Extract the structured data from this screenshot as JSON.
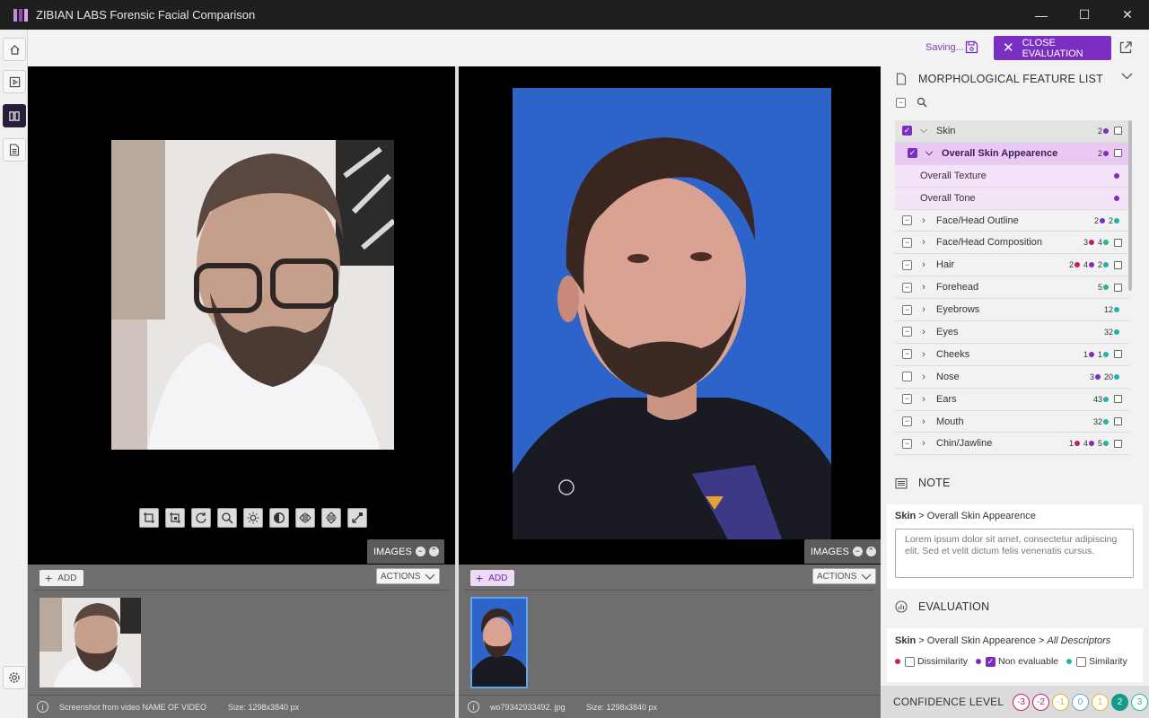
{
  "window": {
    "title": "ZIBIAN LABS Forensic Facial Comparison",
    "minimize": "—",
    "maximize": "☐",
    "close": "✕"
  },
  "rail": {
    "items": [
      "home-icon",
      "video-icon",
      "compare-icon",
      "document-icon"
    ],
    "settings": "gear-icon"
  },
  "toolbar": {
    "saving_label": "Saving...",
    "close_evaluation_label": "CLOSE EVALUATION",
    "close_x": "✕"
  },
  "left_pane": {
    "images_tab": "IMAGES",
    "add_label": "ADD",
    "actions_label": "ACTIONS",
    "info_text": "Screenshot from video NAME OF VIDEO",
    "size_text": "Size: 1298x3840 px",
    "tools": [
      "crop-icon",
      "crop-alt-icon",
      "rotate-icon",
      "zoom-icon",
      "brightness-icon",
      "contrast-icon",
      "flip-horizontal-icon",
      "flip-vertical-icon",
      "expand-icon"
    ]
  },
  "right_pane": {
    "images_tab": "IMAGES",
    "add_label": "ADD",
    "actions_label": "ACTIONS",
    "info_text": "wo79342933492. jpg",
    "size_text": "Size: 1298x3840 px"
  },
  "features": {
    "title": "MORPHOLOGICAL FEATURE LIST",
    "items": [
      {
        "label": "Skin",
        "chev": "⌵",
        "counts": [
          {
            "n": "2",
            "c": "p"
          }
        ],
        "cal": true,
        "state": "checked",
        "style": "sel0"
      },
      {
        "label": "Overall Skin Appearence",
        "chev": "⌵",
        "counts": [
          {
            "n": "2",
            "c": "p"
          }
        ],
        "cal": true,
        "state": "checked",
        "style": "sel1"
      },
      {
        "label": "Overall Texture",
        "chev": "",
        "counts": [
          {
            "n": "",
            "c": "p"
          }
        ],
        "cal": false,
        "state": "none",
        "style": "sub"
      },
      {
        "label": "Overall Tone",
        "chev": "",
        "counts": [
          {
            "n": "",
            "c": "p"
          }
        ],
        "cal": false,
        "state": "none",
        "style": "sub"
      },
      {
        "label": "Face/Head Outline",
        "chev": "›",
        "counts": [
          {
            "n": "2",
            "c": "p"
          },
          {
            "n": "2",
            "c": "t"
          }
        ],
        "cal": false,
        "state": "partial",
        "style": ""
      },
      {
        "label": "Face/Head Composition",
        "chev": "›",
        "counts": [
          {
            "n": "3",
            "c": "r"
          },
          {
            "n": "4",
            "c": "t"
          }
        ],
        "cal": true,
        "state": "partial",
        "style": ""
      },
      {
        "label": "Hair",
        "chev": "›",
        "counts": [
          {
            "n": "2",
            "c": "r"
          },
          {
            "n": "4",
            "c": "p"
          },
          {
            "n": "2",
            "c": "t"
          }
        ],
        "cal": true,
        "state": "partial",
        "style": ""
      },
      {
        "label": "Forehead",
        "chev": "›",
        "counts": [
          {
            "n": "5",
            "c": "t"
          }
        ],
        "cal": true,
        "state": "partial",
        "style": ""
      },
      {
        "label": "Eyebrows",
        "chev": "›",
        "counts": [
          {
            "n": "12",
            "c": "t"
          }
        ],
        "cal": false,
        "state": "partial",
        "style": ""
      },
      {
        "label": "Eyes",
        "chev": "›",
        "counts": [
          {
            "n": "32",
            "c": "t"
          }
        ],
        "cal": false,
        "state": "partial",
        "style": ""
      },
      {
        "label": "Cheeks",
        "chev": "›",
        "counts": [
          {
            "n": "1",
            "c": "p"
          },
          {
            "n": "1",
            "c": "t"
          }
        ],
        "cal": true,
        "state": "partial",
        "style": ""
      },
      {
        "label": "Nose",
        "chev": "›",
        "counts": [
          {
            "n": "3",
            "c": "p"
          },
          {
            "n": "20",
            "c": "t"
          }
        ],
        "cal": false,
        "state": "empty",
        "style": ""
      },
      {
        "label": "Ears",
        "chev": "›",
        "counts": [
          {
            "n": "43",
            "c": "t"
          }
        ],
        "cal": true,
        "state": "partial",
        "style": ""
      },
      {
        "label": "Mouth",
        "chev": "›",
        "counts": [
          {
            "n": "32",
            "c": "t"
          }
        ],
        "cal": true,
        "state": "partial",
        "style": ""
      },
      {
        "label": "Chin/Jawline",
        "chev": "›",
        "counts": [
          {
            "n": "1",
            "c": "r"
          },
          {
            "n": "4",
            "c": "p"
          },
          {
            "n": "5",
            "c": "t"
          }
        ],
        "cal": true,
        "state": "partial",
        "style": ""
      }
    ]
  },
  "note": {
    "title": "NOTE",
    "path_bold": "Skin",
    "path_rest": " > Overall Skin Appearence",
    "text": "Lorem ipsum dolor sit amet, consectetur adipiscing elit. Sed et velit dictum felis venenatis cursus."
  },
  "evaluation": {
    "title": "EVALUATION",
    "path_bold": "Skin",
    "path_mid": " > Overall Skin Appearence > ",
    "path_italic": "All Descriptors",
    "options": [
      {
        "label": "Dissimilarity",
        "color": "#c8196a",
        "checked": false
      },
      {
        "label": "Non evaluable",
        "color": "#7b2ec2",
        "checked": true
      },
      {
        "label": "Similarity",
        "color": "#20b5a4",
        "checked": false
      }
    ]
  },
  "confidence": {
    "label": "CONFIDENCE LEVEL",
    "levels": [
      {
        "v": "-3",
        "color": "#c8196a",
        "active": false
      },
      {
        "v": "-2",
        "color": "#c8196a",
        "active": false
      },
      {
        "v": "-1",
        "color": "#e5b530",
        "active": false
      },
      {
        "v": "0",
        "color": "#5ea6e8",
        "active": false
      },
      {
        "v": "1",
        "color": "#e5b530",
        "active": false
      },
      {
        "v": "2",
        "color": "#159a8a",
        "active": true
      },
      {
        "v": "3",
        "color": "#20b5a4",
        "active": false
      }
    ]
  },
  "colors": {
    "accent": "#7b2ec2",
    "dissimilar": "#c8196a",
    "similar": "#20b5a4"
  }
}
